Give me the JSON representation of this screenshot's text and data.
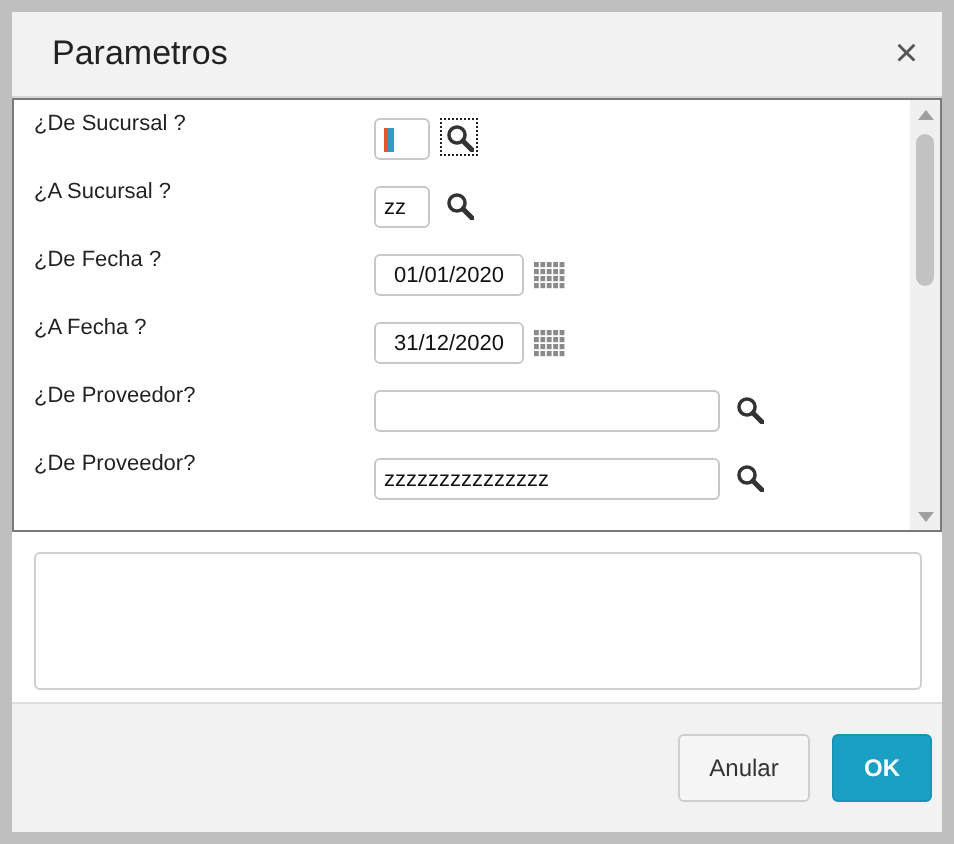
{
  "dialog": {
    "title": "Parametros",
    "close_icon": "×"
  },
  "params": [
    {
      "label": "¿De Sucursal ?",
      "kind": "code",
      "cursor": true,
      "button_focused": true
    },
    {
      "label": "¿A Sucursal ?",
      "kind": "code",
      "value": "zz",
      "cursor": false,
      "button_focused": false
    },
    {
      "label": "¿De Fecha ?",
      "kind": "date",
      "value": "01/01/2020",
      "cursor": false,
      "button_focused": false
    },
    {
      "label": "¿A Fecha ?",
      "kind": "date",
      "value": "31/12/2020",
      "cursor": false,
      "button_focused": false
    },
    {
      "label": "¿De Proveedor?",
      "kind": "text",
      "cursor": false,
      "button_focused": false
    },
    {
      "label": "¿De Proveedor?",
      "kind": "text",
      "value": "zzzzzzzzzzzzzzz",
      "cursor": false,
      "button_focused": false
    }
  ],
  "buttons": [
    {
      "label": "Anular",
      "kind": "secondary"
    },
    {
      "label": "OK",
      "kind": "primary"
    }
  ]
}
